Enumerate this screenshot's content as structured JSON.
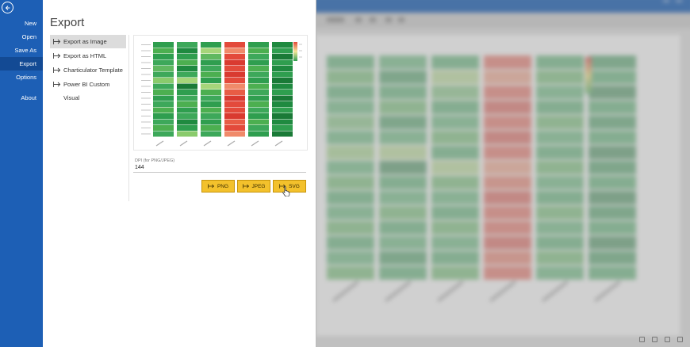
{
  "nav": {
    "items": [
      {
        "key": "new",
        "label": "New",
        "active": false
      },
      {
        "key": "open",
        "label": "Open",
        "active": false
      },
      {
        "key": "save-as",
        "label": "Save As",
        "active": false
      },
      {
        "key": "export",
        "label": "Export",
        "active": true
      },
      {
        "key": "options",
        "label": "Options",
        "active": false
      },
      {
        "key": "about",
        "label": "About",
        "active": false
      }
    ]
  },
  "panel": {
    "title": "Export",
    "options": [
      {
        "key": "image",
        "label": "Export as Image",
        "selected": true
      },
      {
        "key": "html",
        "label": "Export as HTML",
        "selected": false
      },
      {
        "key": "charticulator",
        "label": "Charticulator Template",
        "selected": false
      },
      {
        "key": "powerbi",
        "label": "Power BI Custom Visual",
        "selected": false
      }
    ],
    "dpi": {
      "label": "DPI (for PNG/JPEG)",
      "value": "144"
    },
    "buttons": [
      {
        "key": "png",
        "label": "PNG"
      },
      {
        "key": "jpeg",
        "label": "JPEG"
      },
      {
        "key": "svg",
        "label": "SVG"
      }
    ]
  },
  "preview": {
    "rows": 16,
    "columns": 6,
    "column_colors": [
      [
        "#2f9e4f",
        "#4caf50",
        "#2f9e4f",
        "#3da85a",
        "#60b860",
        "#3da85a",
        "#8acb6c",
        "#3da85a",
        "#4caf50",
        "#2f9e4f",
        "#3da85a",
        "#4caf50",
        "#2f9e4f",
        "#3da85a",
        "#4caf50",
        "#3da85a"
      ],
      [
        "#3da85a",
        "#1f8a40",
        "#2f9e4f",
        "#4caf50",
        "#1f8a40",
        "#3da85a",
        "#a6d57a",
        "#1a7a37",
        "#2f9e4f",
        "#3da85a",
        "#4caf50",
        "#2f9e4f",
        "#3da85a",
        "#1f8a40",
        "#2f9e4f",
        "#8acb6c"
      ],
      [
        "#2f9e4f",
        "#a6d57a",
        "#60b860",
        "#2f9e4f",
        "#3da85a",
        "#4caf50",
        "#2f9e4f",
        "#a6d57a",
        "#4caf50",
        "#3da85a",
        "#2f9e4f",
        "#4caf50",
        "#3da85a",
        "#2f9e4f",
        "#4caf50",
        "#3da85a"
      ],
      [
        "#e34a3b",
        "#f08a6a",
        "#e34a3b",
        "#d93a30",
        "#e34a3b",
        "#d93a30",
        "#e34a3b",
        "#f08a6a",
        "#e85c45",
        "#d93a30",
        "#e34a3b",
        "#e34a3b",
        "#d93a30",
        "#e85c45",
        "#e34a3b",
        "#f08a6a"
      ],
      [
        "#2f9e4f",
        "#4caf50",
        "#3da85a",
        "#2f9e4f",
        "#4caf50",
        "#3da85a",
        "#2f9e4f",
        "#4caf50",
        "#3da85a",
        "#2f9e4f",
        "#4caf50",
        "#3da85a",
        "#2f9e4f",
        "#4caf50",
        "#3da85a",
        "#2f9e4f"
      ],
      [
        "#1f8a40",
        "#2f9e4f",
        "#1a7a37",
        "#2f9e4f",
        "#1f8a40",
        "#2f9e4f",
        "#1a7a37",
        "#1f8a40",
        "#2f9e4f",
        "#1a7a37",
        "#1f8a40",
        "#2f9e4f",
        "#1a7a37",
        "#1f8a40",
        "#2f9e4f",
        "#1a7a37"
      ]
    ],
    "legend_colors": [
      "#e34a3b",
      "#f4e79a",
      "#2f9e4f"
    ]
  },
  "colors": {
    "nav_bg": "#1d5fb5",
    "nav_active": "#134a94",
    "button_bg": "#f3c12c"
  },
  "icons": {
    "back": "back-arrow-icon",
    "option": "export-arrow-icon",
    "button": "export-arrow-icon",
    "cursor": "hand-cursor-icon"
  }
}
